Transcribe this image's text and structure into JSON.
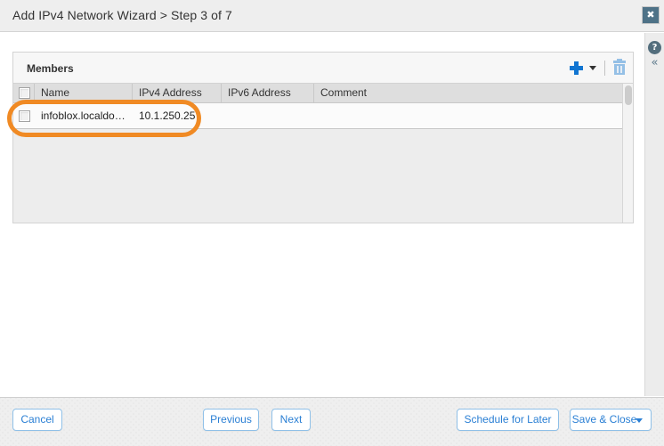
{
  "titlebar": {
    "title": "Add IPv4 Network Wizard > Step 3 of 7",
    "close_icon": "close-icon",
    "close_glyph": "✖"
  },
  "right_rail": {
    "help_icon": "help-icon",
    "help_glyph": "?",
    "collapse_icon": "collapse-left-icon",
    "collapse_glyph": "«"
  },
  "panel": {
    "title": "Members",
    "tools": {
      "add_icon": "add-plus-icon",
      "add_dropdown_icon": "chevron-down-icon",
      "delete_icon": "trash-icon"
    }
  },
  "table": {
    "select_all_checkbox": "select-all-checkbox",
    "columns": [
      "Name",
      "IPv4 Address",
      "IPv6 Address",
      "Comment"
    ],
    "rows": [
      {
        "checked": false,
        "name": "infoblox.localdo…",
        "ipv4_address": "10.1.250.25",
        "ipv6_address": "",
        "comment": ""
      }
    ]
  },
  "annotation": {
    "shape": "highlight-ellipse",
    "color": "#f08a24"
  },
  "footer": {
    "cancel_label": "Cancel",
    "previous_label": "Previous",
    "next_label": "Next",
    "schedule_label": "Schedule for Later",
    "save_close_label": "Save & Close",
    "save_close_dropdown_icon": "chevron-down-icon"
  },
  "colors": {
    "accent_blue": "#1175d1",
    "button_blue": "#2a7fd4",
    "annotation_orange": "#f08a24",
    "titlebar_bg": "#eeeeee",
    "close_button_bg": "#4e7287"
  }
}
